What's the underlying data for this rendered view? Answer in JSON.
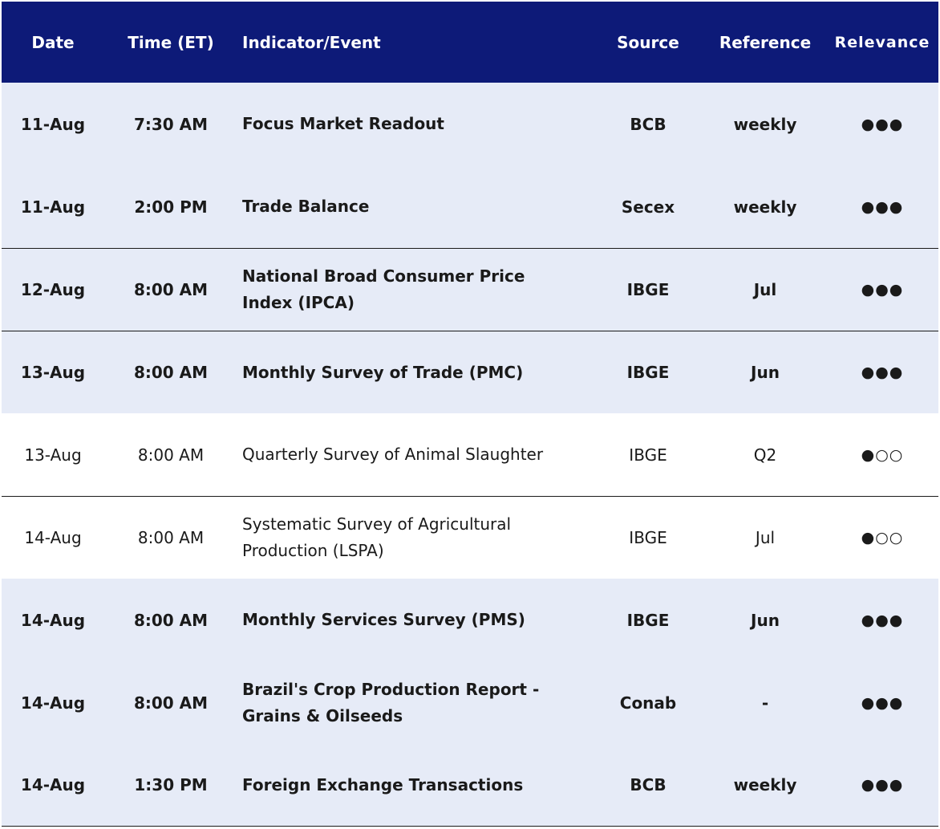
{
  "header": {
    "date": "Date",
    "time": "Time (ET)",
    "indicator": "Indicator/Event",
    "source": "Source",
    "reference": "Reference",
    "relevance": "Relevance"
  },
  "rows": [
    {
      "date": "11-Aug",
      "time": "7:30 AM",
      "indicator": "Focus Market Readout",
      "source": "BCB",
      "reference": "weekly",
      "relevance": "●●●"
    },
    {
      "date": "11-Aug",
      "time": "2:00 PM",
      "indicator": "Trade Balance",
      "source": "Secex",
      "reference": "weekly",
      "relevance": "●●●"
    },
    {
      "date": "12-Aug",
      "time": "8:00 AM",
      "indicator": "National Broad Consumer Price Index (IPCA)",
      "source": "IBGE",
      "reference": "Jul",
      "relevance": "●●●"
    },
    {
      "date": "13-Aug",
      "time": "8:00 AM",
      "indicator": "Monthly Survey of Trade (PMC)",
      "source": "IBGE",
      "reference": "Jun",
      "relevance": "●●●"
    },
    {
      "date": "13-Aug",
      "time": "8:00 AM",
      "indicator": "Quarterly Survey of Animal Slaughter",
      "source": "IBGE",
      "reference": "Q2",
      "relevance": "●○○"
    },
    {
      "date": "14-Aug",
      "time": "8:00 AM",
      "indicator": "Systematic Survey of Agricultural Production (LSPA)",
      "source": "IBGE",
      "reference": "Jul",
      "relevance": "●○○"
    },
    {
      "date": "14-Aug",
      "time": "8:00 AM",
      "indicator": "Monthly Services Survey (PMS)",
      "source": "IBGE",
      "reference": "Jun",
      "relevance": "●●●"
    },
    {
      "date": "14-Aug",
      "time": "8:00 AM",
      "indicator": "Brazil's Crop Production Report - Grains & Oilseeds",
      "source": "Conab",
      "reference": "-",
      "relevance": "●●●"
    },
    {
      "date": "14-Aug",
      "time": "1:30 PM",
      "indicator": "Foreign Exchange Transactions",
      "source": "BCB",
      "reference": "weekly",
      "relevance": "●●●"
    }
  ],
  "colors": {
    "header_bg": "#0d1a78",
    "header_text": "#ffffff",
    "shaded_row_bg": "#e6ebf7",
    "plain_row_bg": "#ffffff",
    "text": "#1a1a1a"
  }
}
